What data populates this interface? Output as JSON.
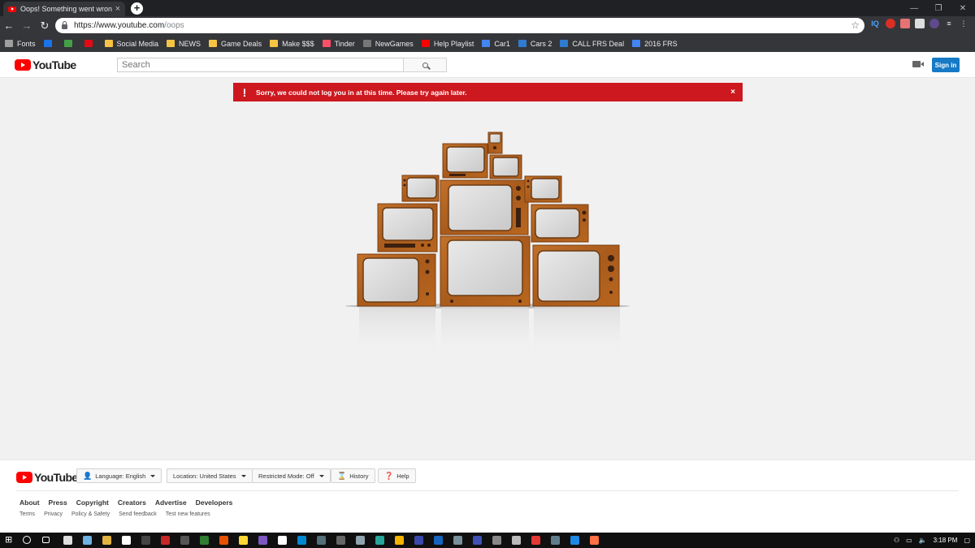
{
  "browser": {
    "tab_title": "Oops! Something went wrong. -",
    "tab_close": "×",
    "new_tab": "+",
    "url_host": "https://www.youtube.com",
    "url_path": "/oops",
    "window_controls": [
      "—",
      "❐",
      "✕"
    ],
    "extensions": [
      "IQ"
    ],
    "bookmarks": [
      {
        "label": "Fonts",
        "color": "#9e9e9e"
      },
      {
        "label": "",
        "color": "#1a73e8"
      },
      {
        "label": "",
        "color": "#43a047"
      },
      {
        "label": "",
        "color": "#e50914"
      },
      {
        "label": "Social Media",
        "color": "#f6c343"
      },
      {
        "label": "NEWS",
        "color": "#f6c343"
      },
      {
        "label": "Game Deals",
        "color": "#f6c343"
      },
      {
        "label": "Make $$$",
        "color": "#f6c343"
      },
      {
        "label": "Tinder",
        "color": "#fd5068"
      },
      {
        "label": "NewGames",
        "color": "#777777"
      },
      {
        "label": "Help Playlist",
        "color": "#ff0000"
      },
      {
        "label": "Car1",
        "color": "#4285f4"
      },
      {
        "label": "Cars 2",
        "color": "#2e7bcf"
      },
      {
        "label": "CALL FRS Deal",
        "color": "#2e7bcf"
      },
      {
        "label": "2016 FRS",
        "color": "#4285f4"
      }
    ]
  },
  "youtube": {
    "logo_text": "YouTube",
    "search_placeholder": "Search",
    "signin_label": "Sign in",
    "alert_icon": "!",
    "alert_message": "Sorry, we could not log you in at this time. Please try again later.",
    "alert_close": "×",
    "footer": {
      "language": "Language: English",
      "location": "Location: United States",
      "restricted": "Restricted Mode: Off",
      "history": "History",
      "help": "Help",
      "links_primary": [
        "About",
        "Press",
        "Copyright",
        "Creators",
        "Advertise",
        "Developers"
      ],
      "links_secondary": [
        "Terms",
        "Privacy",
        "Policy & Safety",
        "Send feedback",
        "Test new features"
      ]
    }
  },
  "taskbar": {
    "time": "3:18 PM"
  },
  "colors": {
    "alert_red": "#cc181e",
    "signin_blue": "#167ac6",
    "tv_wood": "#b5651d",
    "youtube_red": "#ff0000"
  }
}
